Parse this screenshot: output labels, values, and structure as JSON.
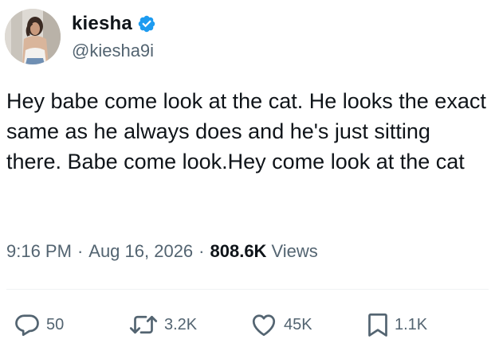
{
  "author": {
    "display_name": "kiesha",
    "handle": "@kiesha9i",
    "verified": true,
    "avatar_icon": "profile-photo",
    "verified_icon": "verified-badge-icon",
    "verified_color": "#1d9bf0"
  },
  "tweet": {
    "text": "Hey babe come look at the cat. He looks the exact same as he always does and he's just sitting there. Babe come look.Hey come look at the cat",
    "time": "9:16 PM",
    "separator": "·",
    "date": "Aug 16, 2026",
    "views_count": "808.6K",
    "views_label": "Views"
  },
  "actions": {
    "reply": {
      "icon": "reply-icon",
      "count": "50"
    },
    "repost": {
      "icon": "repost-icon",
      "count": "3.2K"
    },
    "like": {
      "icon": "heart-icon",
      "count": "45K"
    },
    "bookmark": {
      "icon": "bookmark-icon",
      "count": "1.1K"
    }
  },
  "colors": {
    "text_primary": "#0f1419",
    "text_secondary": "#536471",
    "divider": "#eff3f4"
  }
}
